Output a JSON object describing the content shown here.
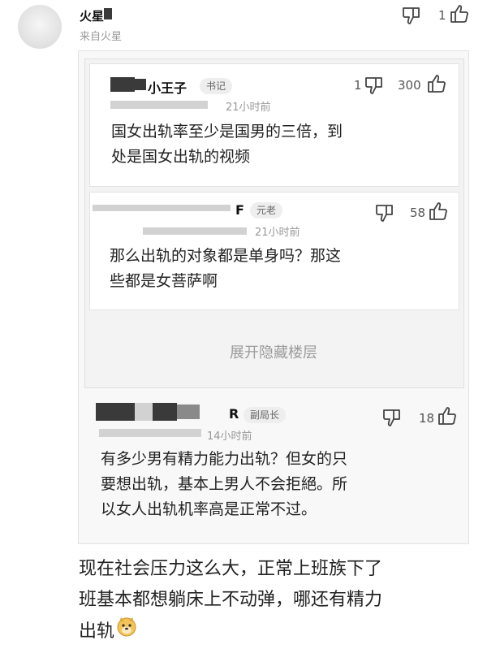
{
  "top_comment": {
    "username": "火星",
    "source": "来自火星",
    "dislike_icon": "thumbs-down-icon",
    "like_icon": "thumbs-up-icon",
    "like_count": "1"
  },
  "thread": {
    "reply1": {
      "username": "小王子",
      "badge": "书记",
      "time": "21小时前",
      "dislike_count": "1",
      "like_count": "300",
      "text_line1": "国女出轨率至少是国男的三倍，到",
      "text_line2": "处是国女出轨的视频"
    },
    "reply2": {
      "username": "F",
      "badge": "元老",
      "time": "21小时前",
      "like_count": "58",
      "text_line1": "那么出轨的对象都是单身吗？那这",
      "text_line2": "些都是女菩萨啊"
    },
    "expand_label": "展开隐藏楼层",
    "reply3": {
      "username": "R",
      "badge": "副局长",
      "time": "14小时前",
      "like_count": "18",
      "text_line1": "有多少男有精力能力出轨？但女的只",
      "text_line2": "要想出轨，基本上男人不会拒絕。所",
      "text_line3": "以女人出轨机率高是正常不过。"
    }
  },
  "main_comment": {
    "line1": "现在社会压力这么大，正常上班族下了",
    "line2": "班基本都想躺床上不动弹，哪还有精力",
    "line3": "出轨",
    "emoji_icon": "doge-emoji-icon"
  }
}
